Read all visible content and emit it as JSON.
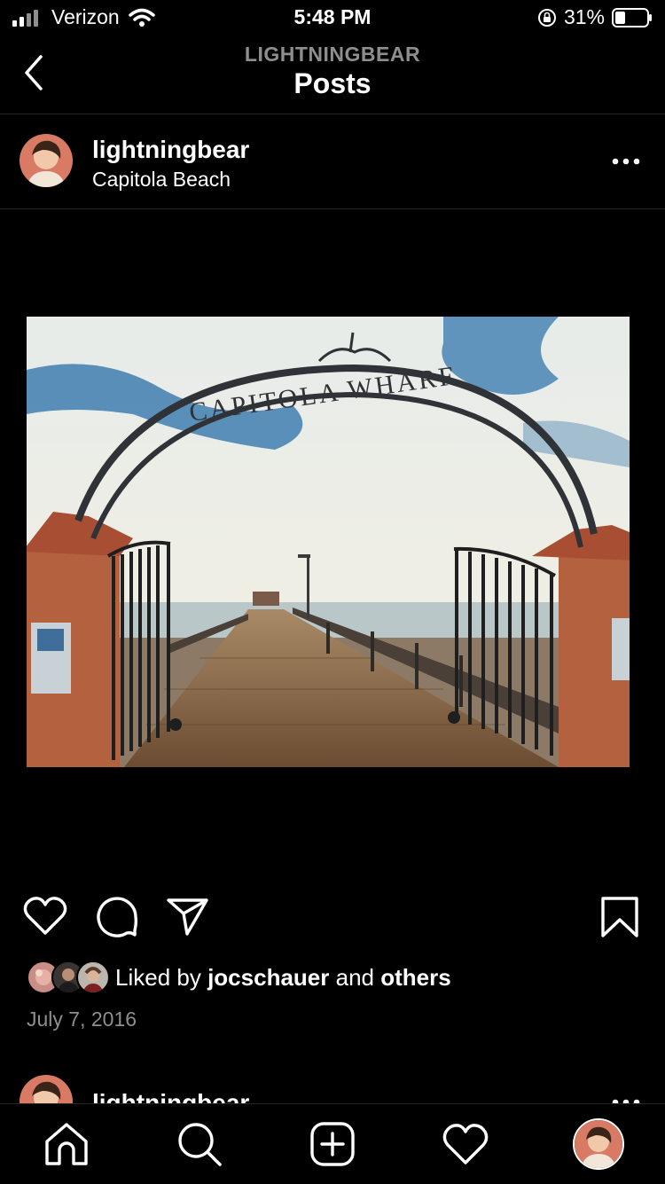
{
  "status_bar": {
    "carrier": "Verizon",
    "time": "5:48 PM",
    "battery": "31%",
    "icons": [
      "signal-icon",
      "wifi-icon",
      "orientation-lock-icon",
      "battery-icon"
    ]
  },
  "nav": {
    "subtitle": "LIGHTNINGBEAR",
    "title": "Posts",
    "back_icon": "chevron-left-icon"
  },
  "post": {
    "username": "lightningbear",
    "location": "Capitola Beach",
    "photo_sign_text": "CAPITOLA WHARF",
    "liked_by_prefix": "Liked by",
    "liked_by_user": "jocschauer",
    "liked_by_and": "and",
    "liked_by_others": "others",
    "date": "July 7, 2016",
    "action_icons": [
      "heart-icon",
      "comment-icon",
      "share-icon",
      "bookmark-icon"
    ]
  },
  "next_post": {
    "username": "lightningbear"
  },
  "tabbar": {
    "icons": [
      "home-icon",
      "search-icon",
      "new-post-icon",
      "activity-icon",
      "profile-avatar"
    ]
  },
  "colors": {
    "background": "#000000",
    "secondary_text": "#8e8e8e",
    "divider": "#262626"
  }
}
